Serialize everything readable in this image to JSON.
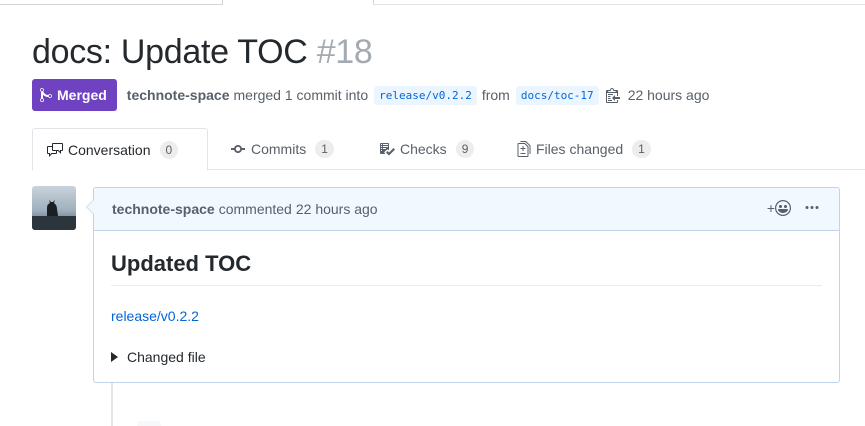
{
  "pr": {
    "title": "docs: Update TOC",
    "number": "#18",
    "state": "Merged",
    "author": "technote-space",
    "action": "merged 1 commit into",
    "base_branch": "release/v0.2.2",
    "from_word": "from",
    "head_branch": "docs/toc-17",
    "time": "22 hours ago"
  },
  "tabs": [
    {
      "label": "Conversation",
      "count": "0",
      "icon": "comment-discussion-icon"
    },
    {
      "label": "Commits",
      "count": "1",
      "icon": "git-commit-icon"
    },
    {
      "label": "Checks",
      "count": "9",
      "icon": "checklist-icon"
    },
    {
      "label": "Files changed",
      "count": "1",
      "icon": "file-diff-icon"
    }
  ],
  "comment": {
    "author": "technote-space",
    "action": "commented",
    "time": "22 hours ago",
    "reaction_plus": "+",
    "heading": "Updated TOC",
    "link_text": "release/v0.2.2",
    "details_summary": "Changed file"
  },
  "colors": {
    "merged": "#6f42c1",
    "link": "#0366d6",
    "branch_bg": "#eaf5ff",
    "comment_header_bg": "#f1f8ff",
    "comment_border": "#c0d3eb"
  }
}
